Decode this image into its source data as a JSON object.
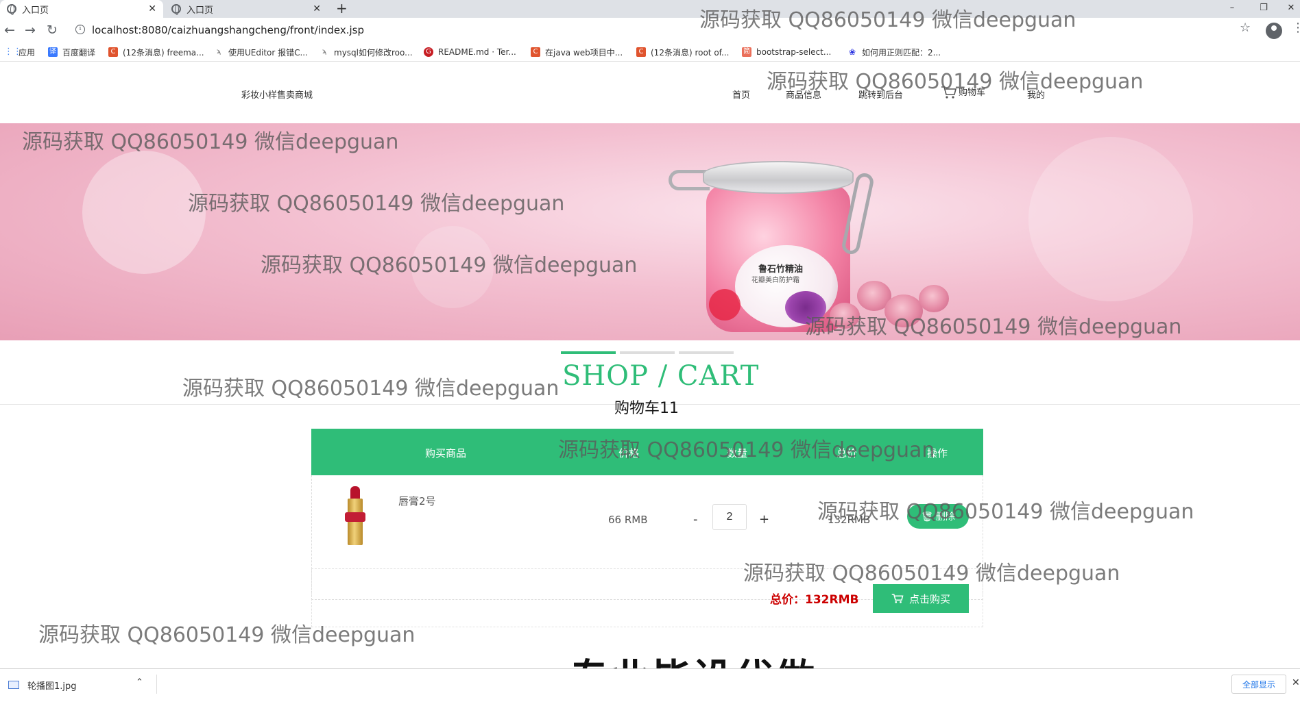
{
  "browser": {
    "tabs": [
      {
        "title": "入口页"
      },
      {
        "title": "入口页"
      }
    ],
    "new_tab": "+",
    "window_controls": {
      "minimize": "–",
      "restore": "❐",
      "close": "✕"
    },
    "url": "localhost:8080/caizhuangshangcheng/front/index.jsp",
    "nav": {
      "back": "←",
      "forward": "→",
      "reload": "↻"
    },
    "bookmarks": [
      {
        "label": "应用",
        "icon": "apps-grid-icon",
        "color": "#4285f4"
      },
      {
        "label": "百度翻译",
        "icon": "baidu-translate-icon",
        "color": "#3a7afe"
      },
      {
        "label": "(12条消息) freema...",
        "icon": "csdn-icon",
        "color": "#e0542e"
      },
      {
        "label": "使用UEditor 报错C...",
        "icon": "bird-icon",
        "color": "#555555"
      },
      {
        "label": "mysql如何修改roo...",
        "icon": "bird-icon",
        "color": "#555555"
      },
      {
        "label": "README.md · Ter...",
        "icon": "gitee-icon",
        "color": "#c71d23"
      },
      {
        "label": "在java web项目中...",
        "icon": "csdn-icon",
        "color": "#e0542e"
      },
      {
        "label": "(12条消息) root of...",
        "icon": "csdn-icon",
        "color": "#e0542e"
      },
      {
        "label": "bootstrap-select...",
        "icon": "jianshu-icon",
        "color": "#ea6f5a"
      },
      {
        "label": "如何用正则匹配：2...",
        "icon": "baidu-paw-icon",
        "color": "#2932e1"
      }
    ]
  },
  "site": {
    "brand": "彩妆小样售卖商城",
    "nav": {
      "home": "首页",
      "products": "商品信息",
      "admin": "跳转到后台",
      "cart": "购物车",
      "mine": "我的"
    }
  },
  "banner": {
    "label_title": "鲁石竹精油",
    "label_sub": "花瓣美白防护霜"
  },
  "cart": {
    "title": "SHOP / CART",
    "subtitle": "购物车11",
    "headers": {
      "product": "购买商品",
      "price": "价格",
      "quantity": "数量",
      "total": "总价",
      "action": "操作"
    },
    "items": [
      {
        "name": "唇膏2号",
        "price": "66 RMB",
        "quantity": "2",
        "subtotal": "132RMB",
        "delete_label": "删除"
      }
    ],
    "qty_minus": "-",
    "qty_plus": "+",
    "total_label": "总价：132RMB",
    "buy_label": "点击购买"
  },
  "overlay": {
    "watermark": "源码获取 QQ86050149 微信deepguan",
    "promo": "专业毕设代做"
  },
  "downloads": {
    "file": "轮播图1.jpg",
    "show_all": "全部显示"
  },
  "colors": {
    "accent": "#2fbd78",
    "total_red": "#cc0000",
    "banner_pink": "#f3bfd0"
  }
}
